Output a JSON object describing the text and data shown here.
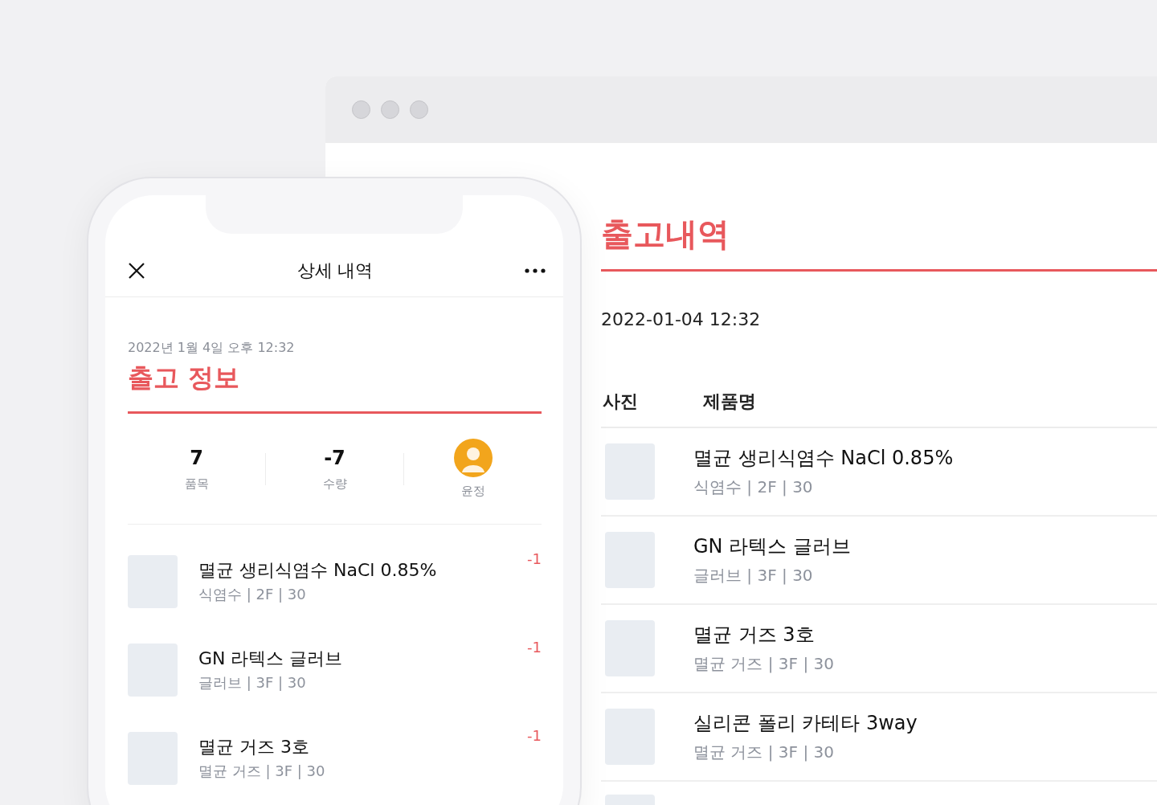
{
  "browser": {
    "heading": "출고내역",
    "date": "2022-01-04 12:32",
    "columns": [
      "사진",
      "제품명"
    ],
    "rows": [
      {
        "kind": "product",
        "name": "멸균 생리식염수 NaCl 0.85%",
        "details": "식염수 | 2F | 30"
      },
      {
        "kind": "product",
        "name": "GN 라텍스 글러브",
        "details": "글러브 | 3F | 30"
      },
      {
        "kind": "product",
        "name": "멸균 거즈 3호",
        "details": "멸균 거즈 | 3F | 30"
      },
      {
        "kind": "product",
        "name": "실리콘 폴리 카테타 3way",
        "details": "멸균 거즈 | 3F | 30"
      },
      {
        "kind": "photo_only"
      }
    ]
  },
  "phone": {
    "title": "상세 내역",
    "date": "2022년 1월 4일 오후 12:32",
    "heading": "출고 정보",
    "stats": [
      {
        "kind": "number",
        "value": "7",
        "label": "품목"
      },
      {
        "kind": "number",
        "value": "-7",
        "label": "수량"
      },
      {
        "kind": "avatar",
        "label": "윤정"
      }
    ],
    "items": [
      {
        "name": "멸균 생리식염수 NaCl 0.85%",
        "details": "식염수 | 2F | 30",
        "quantity": "-1"
      },
      {
        "name": "GN 라텍스 글러브",
        "details": "글러브 | 3F | 30",
        "quantity": "-1"
      },
      {
        "name": "멸균 거즈 3호",
        "details": "멸균 거즈 | 3F | 30",
        "quantity": "-1"
      }
    ]
  }
}
